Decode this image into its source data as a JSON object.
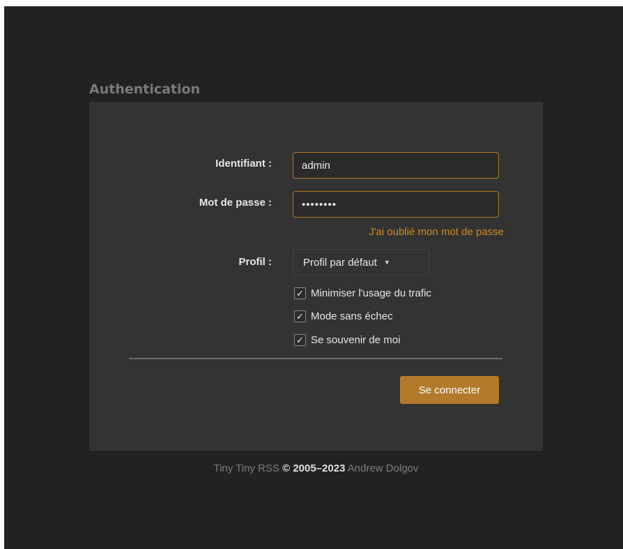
{
  "auth": {
    "title": "Authentication",
    "login_label": "Identifiant :",
    "login_value": "admin",
    "password_label": "Mot de passe :",
    "password_value": "••••••••",
    "forgot_link": "J'ai oublié mon mot de passe",
    "profile_label": "Profil :",
    "profile_selected": "Profil par défaut",
    "checkboxes": [
      {
        "label": "Minimiser l'usage du trafic",
        "checked": true
      },
      {
        "label": "Mode sans échec",
        "checked": true
      },
      {
        "label": "Se souvenir de moi",
        "checked": true
      }
    ],
    "submit_label": "Se connecter"
  },
  "footer": {
    "app_name": "Tiny Tiny RSS",
    "copyright": "© 2005–2023",
    "author": "Andrew Dolgov"
  },
  "colors": {
    "background": "#222222",
    "panel": "#333333",
    "accent": "#b27a2a",
    "link": "#d18a1f"
  },
  "icons": {
    "checkmark": "checkmark-icon",
    "dropdown": "caret-down-icon"
  }
}
